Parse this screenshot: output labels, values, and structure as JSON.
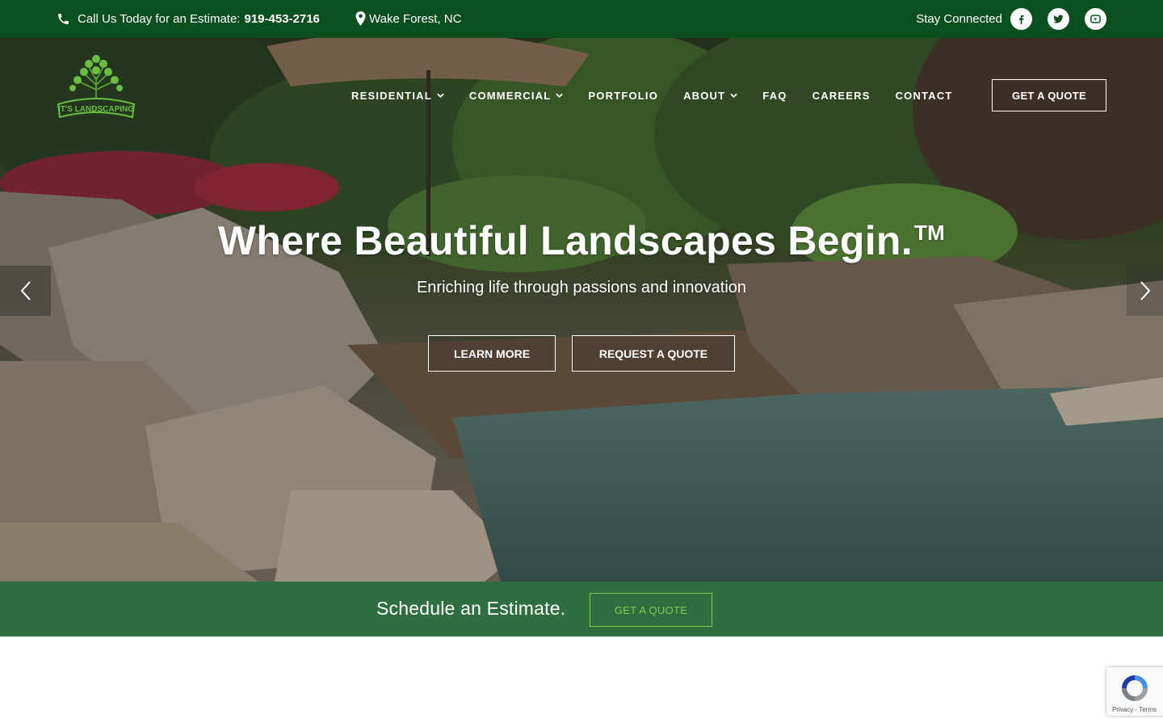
{
  "topbar": {
    "phone_label": "Call Us Today for an Estimate:",
    "phone_number": "919-453-2716",
    "location": "Wake Forest, NC",
    "social_label": "Stay Connected",
    "icons": [
      "phone-icon",
      "map-pin-icon",
      "facebook-icon",
      "twitter-icon",
      "youtube-icon"
    ]
  },
  "brand": {
    "logo_text": "IT'S LANDSCAPING"
  },
  "nav": {
    "items": [
      {
        "label": "RESIDENTIAL",
        "dropdown": true
      },
      {
        "label": "COMMERCIAL",
        "dropdown": true
      },
      {
        "label": "PORTFOLIO",
        "dropdown": false
      },
      {
        "label": "ABOUT",
        "dropdown": true
      },
      {
        "label": "FAQ",
        "dropdown": false
      },
      {
        "label": "CAREERS",
        "dropdown": false
      },
      {
        "label": "CONTACT",
        "dropdown": false
      }
    ],
    "quote_label": "GET A QUOTE"
  },
  "hero": {
    "headline": "Where Beautiful Landscapes Begin.",
    "trademark": "TM",
    "subline": "Enriching life through passions and innovation",
    "learn_more_label": "LEARN MORE",
    "request_quote_label": "REQUEST A QUOTE"
  },
  "estimate": {
    "text": "Schedule an Estimate.",
    "button_label": "GET A QUOTE"
  },
  "recaptcha": {
    "privacy": "Privacy",
    "separator": " - ",
    "terms": "Terms"
  },
  "colors": {
    "topbar": "#0c4f1f",
    "estimate_strip": "#2f6e41",
    "estimate_button": "#7fcc4a"
  }
}
